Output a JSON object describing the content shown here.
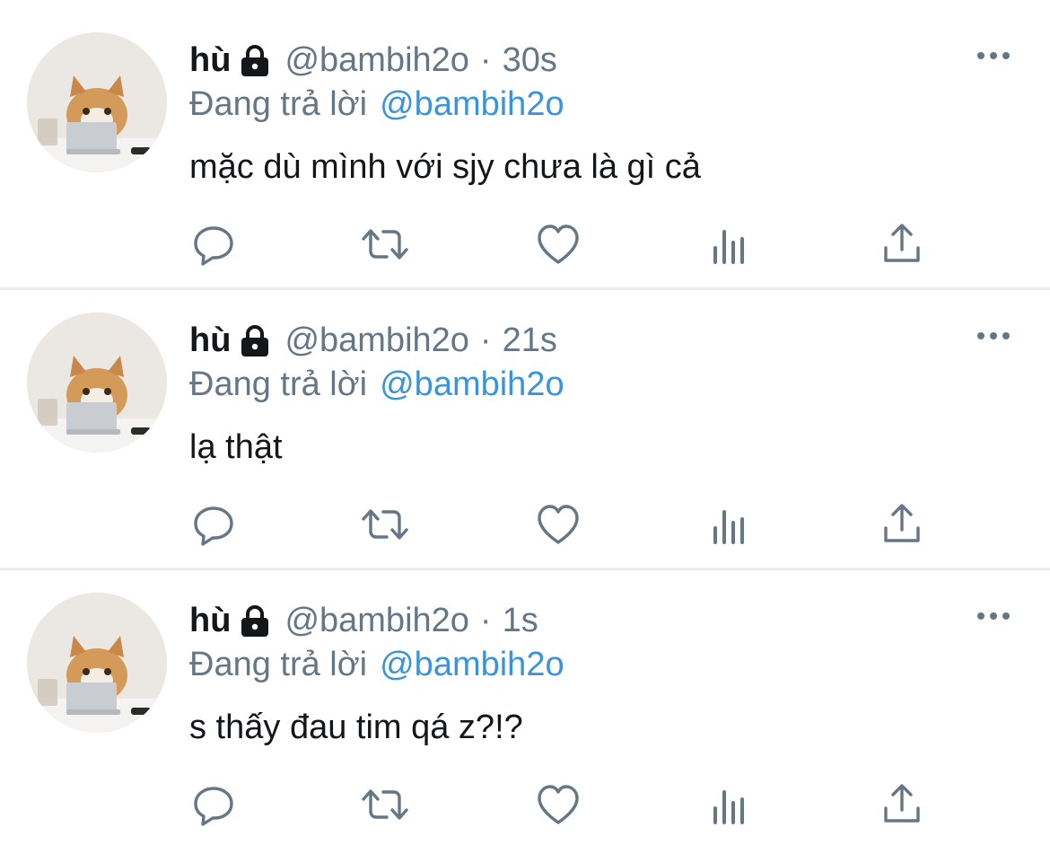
{
  "tweets": [
    {
      "name": "hù",
      "handle": "@bambih2o",
      "separator": "·",
      "time": "30s",
      "replying_prefix": "Đang trả lời",
      "replying_to": "@bambih2o",
      "text": "mặc dù mình với sjy chưa là gì cả"
    },
    {
      "name": "hù",
      "handle": "@bambih2o",
      "separator": "·",
      "time": "21s",
      "replying_prefix": "Đang trả lời",
      "replying_to": "@bambih2o",
      "text": "lạ thật"
    },
    {
      "name": "hù",
      "handle": "@bambih2o",
      "separator": "·",
      "time": "1s",
      "replying_prefix": "Đang trả lời",
      "replying_to": "@bambih2o",
      "text": "s thấy đau tim qá z?!?"
    }
  ],
  "icons": {
    "lock": "lock-icon",
    "more": "more-icon",
    "reply": "reply-icon",
    "retweet": "retweet-icon",
    "like": "like-icon",
    "stats": "stats-icon",
    "share": "share-icon"
  },
  "colors": {
    "text": "#14171a",
    "secondary": "#657786",
    "mention": "#3b94d9",
    "divider": "#e6ecf0"
  }
}
